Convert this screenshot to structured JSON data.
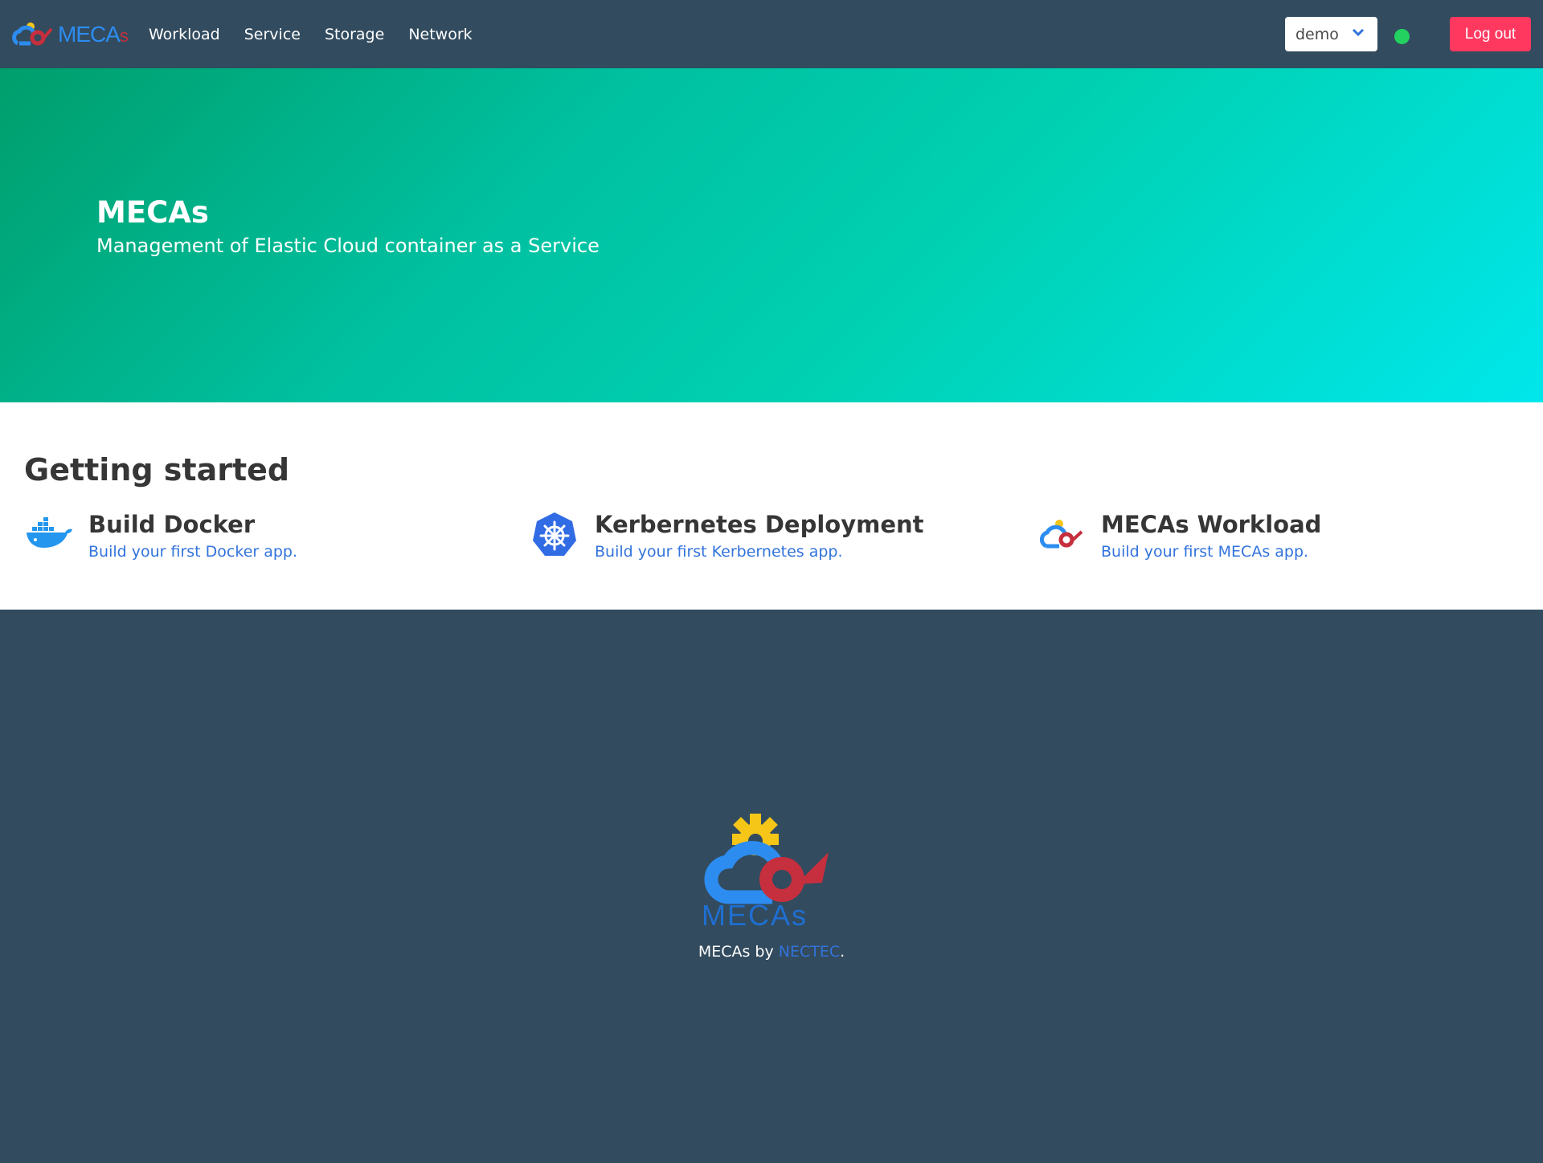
{
  "navbar": {
    "brand": {
      "text": "MECA",
      "suffix": "s"
    },
    "links": [
      "Workload",
      "Service",
      "Storage",
      "Network"
    ],
    "user_select": {
      "value": "demo"
    },
    "status": {
      "color": "#23d160",
      "icon": "online-status-dot"
    },
    "logout_label": "Log out"
  },
  "hero": {
    "title": "MECAs",
    "subtitle": "Management of Elastic Cloud container as a Service"
  },
  "getting_started": {
    "title": "Getting started",
    "cards": [
      {
        "icon": "docker-whale-icon",
        "title": "Build Docker",
        "subtitle": "Build your first Docker app."
      },
      {
        "icon": "kubernetes-helm-icon",
        "title": "Kerbernetes Deployment",
        "subtitle": "Build your first Kerbernetes app."
      },
      {
        "icon": "mecas-logo-icon",
        "title": "MECAs Workload",
        "subtitle": "Build your first MECAs app."
      }
    ]
  },
  "footer": {
    "logo_text": "MECAs",
    "prefix": "MECAs by ",
    "link": "NECTEC",
    "suffix": "."
  },
  "colors": {
    "navbar": "#324b5e",
    "hero_start": "#009e6c",
    "hero_end": "#00e7eb",
    "link": "#3273dc",
    "logout": "#ff3860",
    "status": "#23d160"
  }
}
